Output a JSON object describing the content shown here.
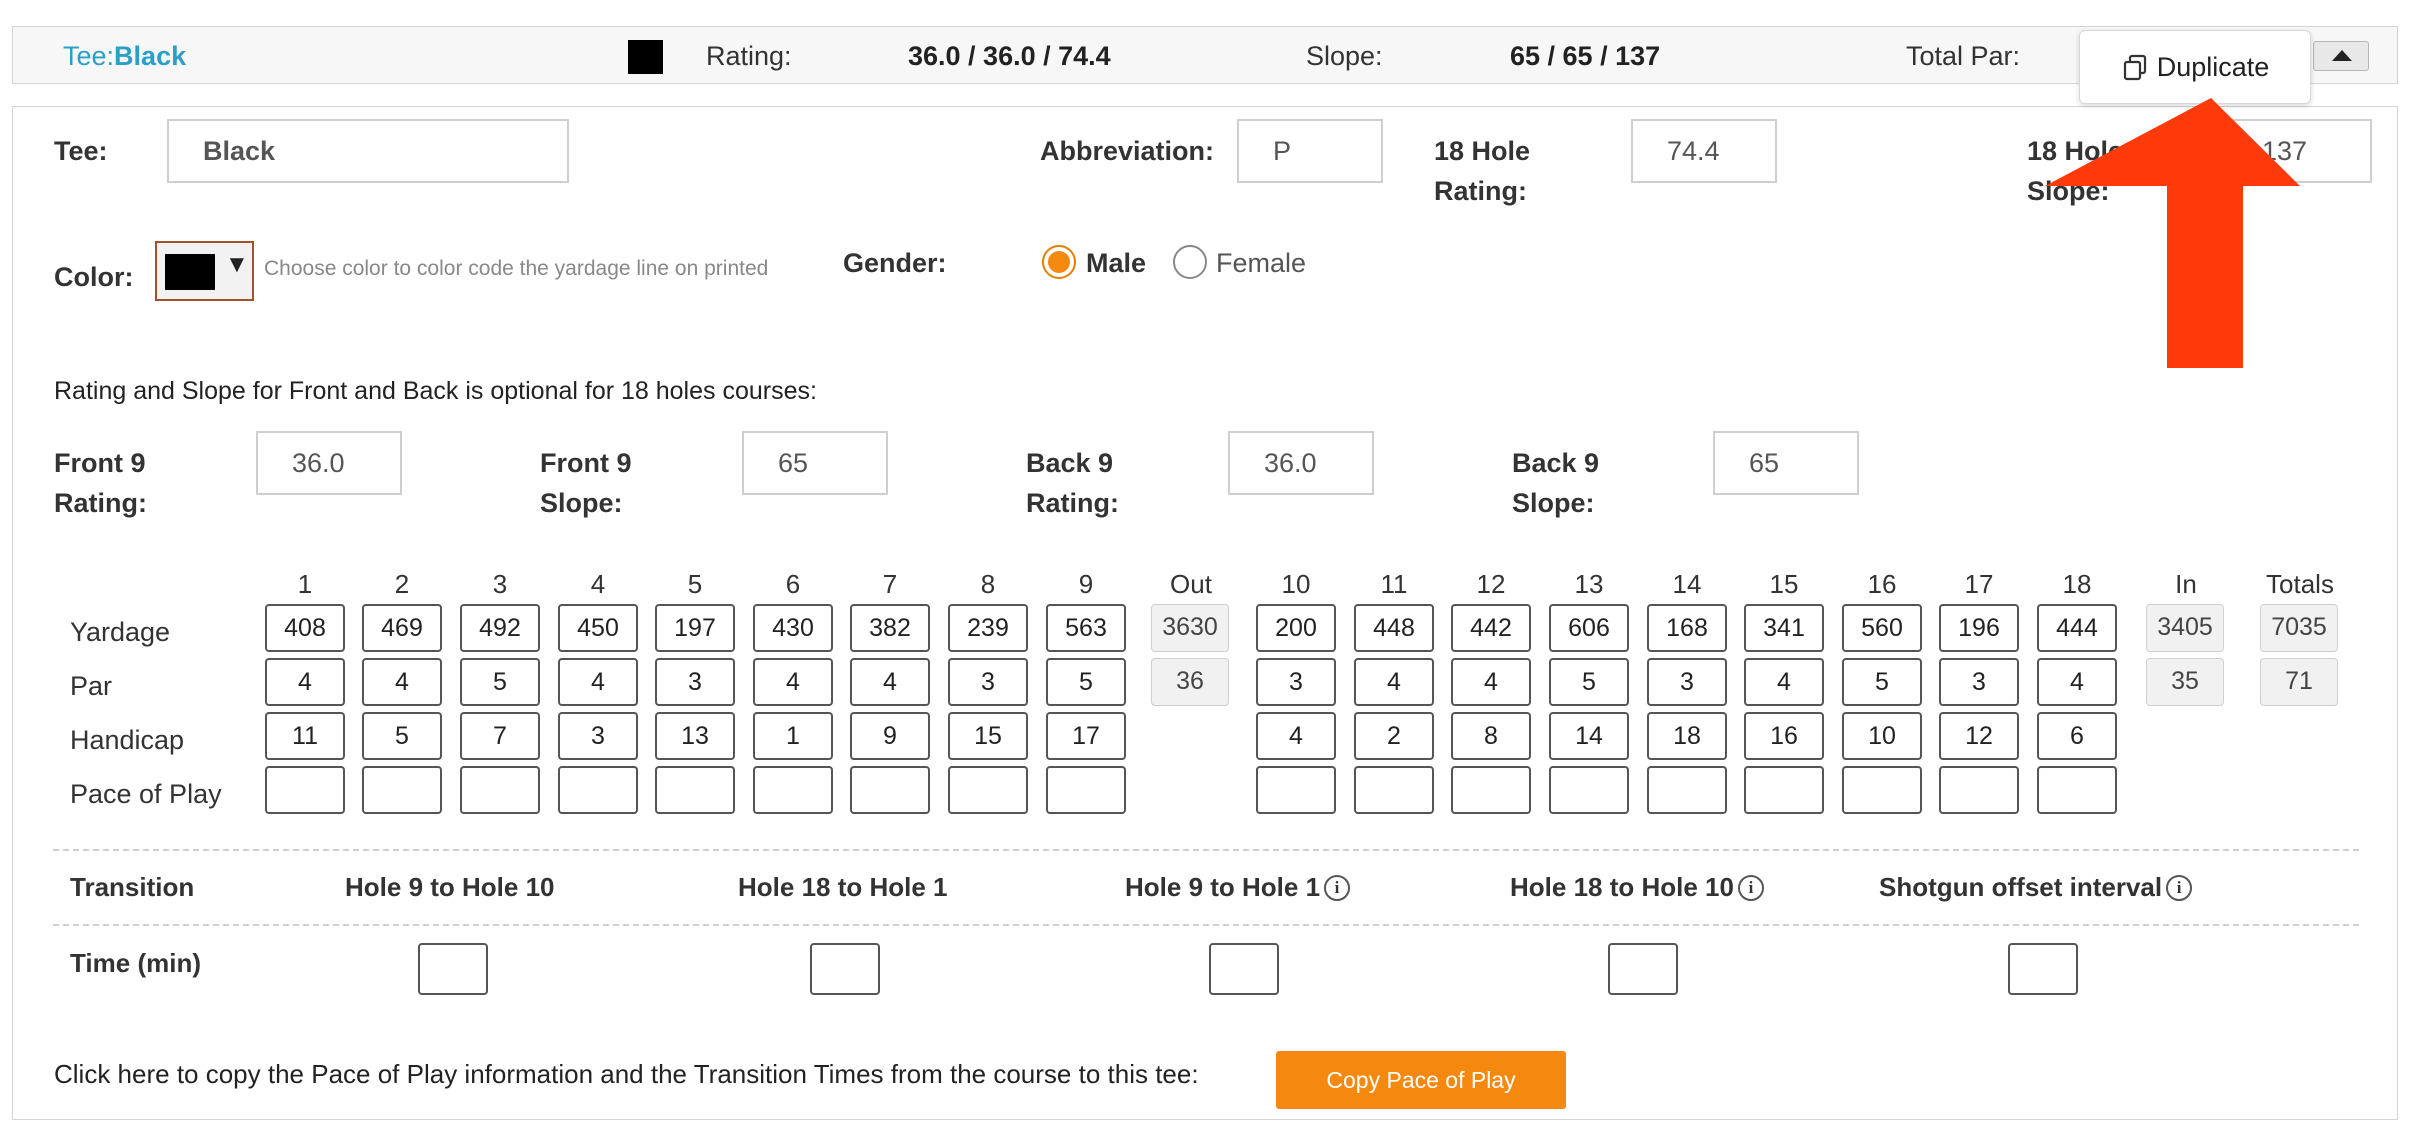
{
  "summary": {
    "tee_prefix": "Tee:",
    "tee_name": "Black",
    "rating_label": "Rating:",
    "rating_value": "36.0 / 36.0 / 74.4",
    "slope_label": "Slope:",
    "slope_value": "65 / 65 / 137",
    "total_par_label": "Total Par:",
    "swatch_color": "#000000"
  },
  "popover": {
    "duplicate_label": "Duplicate"
  },
  "form": {
    "tee_label": "Tee:",
    "tee_value": "Black",
    "abbreviation_label": "Abbreviation:",
    "abbreviation_value": "P",
    "rating18_label_line1": "18 Hole",
    "rating18_label_line2": "Rating:",
    "rating18_value": "74.4",
    "slope18_label_line1": "18 Hole",
    "slope18_label_line2": "Slope:",
    "slope18_value": "137",
    "color_label": "Color:",
    "color_value": "#000000",
    "color_hint": "Choose color to color code the yardage line on printed",
    "gender_label": "Gender:",
    "gender_options": [
      "Male",
      "Female"
    ],
    "gender_selected": "Male",
    "optional_note": "Rating and Slope for Front and Back is optional for 18 holes courses:",
    "front9_rating_label_line1": "Front 9",
    "front9_rating_label_line2": "Rating:",
    "front9_rating_value": "36.0",
    "front9_slope_label_line1": "Front 9",
    "front9_slope_label_line2": "Slope:",
    "front9_slope_value": "65",
    "back9_rating_label_line1": "Back 9",
    "back9_rating_label_line2": "Rating:",
    "back9_rating_value": "36.0",
    "back9_slope_label_line1": "Back 9",
    "back9_slope_label_line2": "Slope:",
    "back9_slope_value": "65"
  },
  "scorecard": {
    "row_labels": [
      "Yardage",
      "Par",
      "Handicap",
      "Pace of Play"
    ],
    "front_holes": [
      "1",
      "2",
      "3",
      "4",
      "5",
      "6",
      "7",
      "8",
      "9"
    ],
    "back_holes": [
      "10",
      "11",
      "12",
      "13",
      "14",
      "15",
      "16",
      "17",
      "18"
    ],
    "out_label": "Out",
    "in_label": "In",
    "totals_label": "Totals",
    "front_yardage": [
      "408",
      "469",
      "492",
      "450",
      "197",
      "430",
      "382",
      "239",
      "563"
    ],
    "back_yardage": [
      "200",
      "448",
      "442",
      "606",
      "168",
      "341",
      "560",
      "196",
      "444"
    ],
    "front_par": [
      "4",
      "4",
      "5",
      "4",
      "3",
      "4",
      "4",
      "3",
      "5"
    ],
    "back_par": [
      "3",
      "4",
      "4",
      "5",
      "3",
      "4",
      "5",
      "3",
      "4"
    ],
    "front_handicap": [
      "11",
      "5",
      "7",
      "3",
      "13",
      "1",
      "9",
      "15",
      "17"
    ],
    "back_handicap": [
      "4",
      "2",
      "8",
      "14",
      "18",
      "16",
      "10",
      "12",
      "6"
    ],
    "out_yardage": "3630",
    "out_par": "36",
    "in_yardage": "3405",
    "in_par": "35",
    "total_yardage": "7035",
    "total_par": "71"
  },
  "transitions": {
    "row_label": "Transition",
    "time_label": "Time (min)",
    "columns": [
      "Hole 9 to Hole 10",
      "Hole 18 to Hole 1",
      "Hole 9 to Hole 1",
      "Hole 18 to Hole 10",
      "Shotgun offset interval"
    ]
  },
  "footer": {
    "copy_note": "Click here to copy the Pace of Play information and the Transition Times from the course to this tee:",
    "copy_button": "Copy Pace of Play"
  }
}
